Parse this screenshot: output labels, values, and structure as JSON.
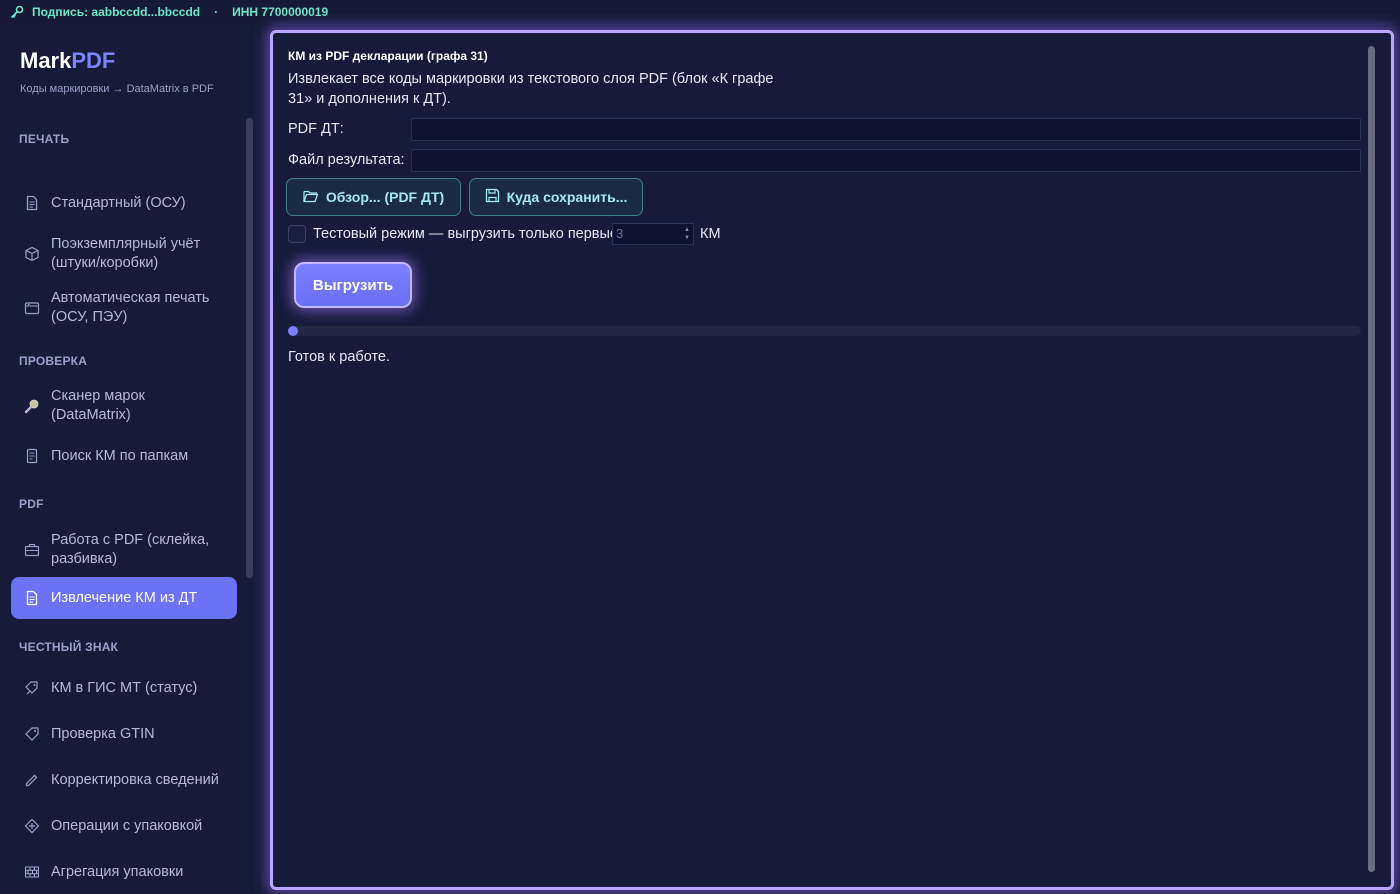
{
  "topbar": {
    "signature": "Подпись: aabbccdd...bbccdd",
    "separator": "·",
    "inn": "ИНН 7700000019"
  },
  "brand": {
    "name_part1": "Mark",
    "name_part2": "PDF",
    "subtitle": "Коды маркировки → DataMatrix в PDF"
  },
  "sidebar": {
    "sections": [
      {
        "label": "ПЕЧАТЬ"
      },
      {
        "label": "ПРОВЕРКА"
      },
      {
        "label": "PDF"
      },
      {
        "label": "ЧЕСТНЫЙ ЗНАК"
      }
    ],
    "items": [
      {
        "label": "Стандартный (ОСУ)",
        "icon": "document-icon"
      },
      {
        "label": "Поэкземплярный учёт (штуки/коробки)",
        "icon": "box-icon"
      },
      {
        "label": "Автоматическая печать (ОСУ, ПЭУ)",
        "icon": "window-icon"
      },
      {
        "label": "Сканер марок (DataMatrix)",
        "icon": "magnifier-icon"
      },
      {
        "label": "Поиск КМ по папкам",
        "icon": "file-list-icon"
      },
      {
        "label": "Работа с PDF (склейка, разбивка)",
        "icon": "briefcase-icon"
      },
      {
        "label": "Извлечение КМ из ДТ",
        "icon": "document-extract-icon",
        "active": true
      },
      {
        "label": "КМ в ГИС МТ (статус)",
        "icon": "tags-icon"
      },
      {
        "label": "Проверка GTIN",
        "icon": "tag-icon"
      },
      {
        "label": "Корректировка сведений",
        "icon": "pencil-icon"
      },
      {
        "label": "Операции с упаковкой",
        "icon": "package-ops-icon"
      },
      {
        "label": "Агрегация упаковки",
        "icon": "bricks-icon"
      }
    ]
  },
  "main": {
    "title": "КМ из PDF декларации (графа 31)",
    "description": "Извлекает все коды маркировки из текстового слоя PDF (блок «К графе 31» и дополнения к ДТ).",
    "pdf_label": "PDF ДТ:",
    "pdf_value": "",
    "result_label": "Файл результата:",
    "result_value": "",
    "browse_button": "Обзор... (PDF ДТ)",
    "save_button": "Куда сохранить...",
    "test_mode_label": "Тестовый режим — выгрузить только первые",
    "test_mode_checked": false,
    "test_count": "3",
    "test_unit": "КМ",
    "export_button": "Выгрузить",
    "progress": 0,
    "status": "Готов к работе."
  },
  "colors": {
    "accent": "#6b72f5",
    "topbar_text": "#6ee7c9",
    "panel_glow": "#b9a6ff"
  }
}
